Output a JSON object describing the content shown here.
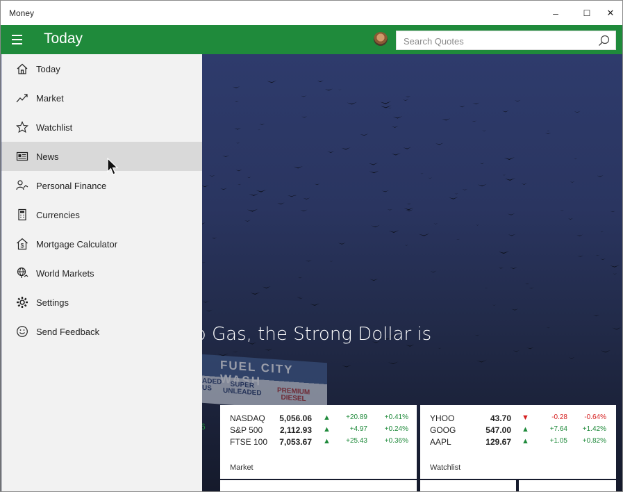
{
  "window": {
    "title": "Money",
    "minimize_glyph": "–",
    "maximize_glyph": "☐",
    "close_glyph": "✕"
  },
  "appbar": {
    "title": "Today",
    "menu_icon": "hamburger-icon",
    "avatar_icon": "user-avatar"
  },
  "search": {
    "placeholder": "Search Quotes",
    "icon": "search-icon"
  },
  "nav": [
    {
      "label": "Today",
      "icon": "home-icon"
    },
    {
      "label": "Market",
      "icon": "trend-icon"
    },
    {
      "label": "Watchlist",
      "icon": "star-icon"
    },
    {
      "label": "News",
      "icon": "news-icon"
    },
    {
      "label": "Personal Finance",
      "icon": "personal-finance-icon"
    },
    {
      "label": "Currencies",
      "icon": "calculator-icon"
    },
    {
      "label": "Mortgage Calculator",
      "icon": "house-dollar-icon"
    },
    {
      "label": "World Markets",
      "icon": "globe-icon"
    },
    {
      "label": "Settings",
      "icon": "gear-icon"
    },
    {
      "label": "Send Feedback",
      "icon": "smiley-icon"
    }
  ],
  "hero": {
    "headline": "ong Dollar and Cheap Gas, the Strong Dollar is"
  },
  "sign": {
    "line1": "FUEL CITY WASH",
    "left_a": "ADED",
    "left_b": "US",
    "mid_a": "SUPER",
    "mid_b": "UNLEADED",
    "right_a": "PREMIUM",
    "right_b": "DIESEL"
  },
  "market_card": {
    "label": "Market",
    "rows": [
      {
        "symbol": "NASDAQ",
        "value": "5,056.06",
        "dir": "up",
        "change": "+20.89",
        "percent": "+0.41%"
      },
      {
        "symbol": "S&P 500",
        "value": "2,112.93",
        "dir": "up",
        "change": "+4.97",
        "percent": "+0.24%"
      },
      {
        "symbol": "FTSE 100",
        "value": "7,053.67",
        "dir": "up",
        "change": "+25.43",
        "percent": "+0.36%"
      }
    ]
  },
  "watchlist_card": {
    "label": "Watchlist",
    "rows": [
      {
        "symbol": "YHOO",
        "value": "43.70",
        "dir": "down",
        "change": "-0.28",
        "percent": "-0.64%"
      },
      {
        "symbol": "GOOG",
        "value": "547.00",
        "dir": "up",
        "change": "+7.64",
        "percent": "+1.42%"
      },
      {
        "symbol": "AAPL",
        "value": "129.67",
        "dir": "up",
        "change": "+1.05",
        "percent": "+0.82%"
      }
    ]
  },
  "left_card": {
    "partial_text": "6"
  },
  "colors": {
    "accent": "#1f8a3b",
    "down": "#d62020",
    "sidebar_bg": "#f2f2f2",
    "hover_bg": "#d9d9d9"
  }
}
